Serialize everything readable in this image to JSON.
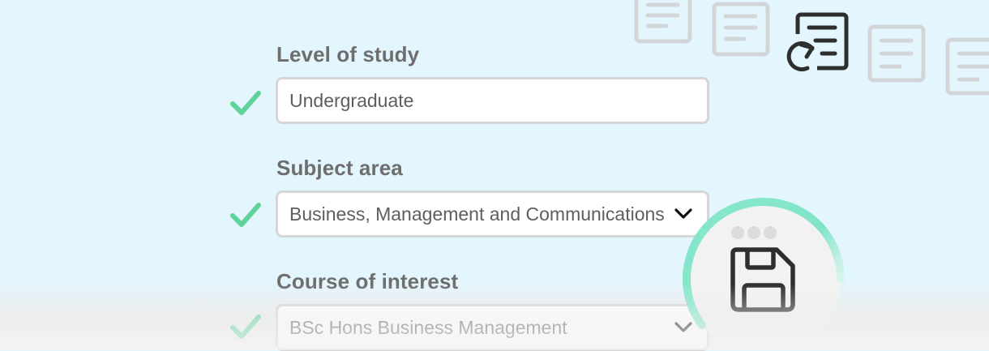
{
  "form": {
    "level_of_study": {
      "label": "Level of study",
      "value": "Undergraduate",
      "status_icon": "check-icon"
    },
    "subject_area": {
      "label": "Subject area",
      "value": "Business, Management and Communications",
      "status_icon": "check-icon"
    },
    "course_of_interest": {
      "label": "Course of interest",
      "value": "BSc Hons Business Management",
      "status_icon": "check-icon"
    }
  },
  "decorations": {
    "background_icons": [
      "document-icon",
      "document-icon",
      "document-swap-icon",
      "document-icon",
      "document-icon"
    ],
    "save_badge_icon": "floppy-disk-icon",
    "save_badge_dots_icon": "more-dots-icon"
  },
  "colors": {
    "background": "#e3f6fd",
    "check_green": "#5fd39a",
    "ring_teal": "#7fe3c8",
    "label_gray": "#6e6e6e",
    "field_border": "#d6d6d6",
    "icon_dark": "#2e2e2e",
    "icon_faded": "#d3d6d8"
  }
}
